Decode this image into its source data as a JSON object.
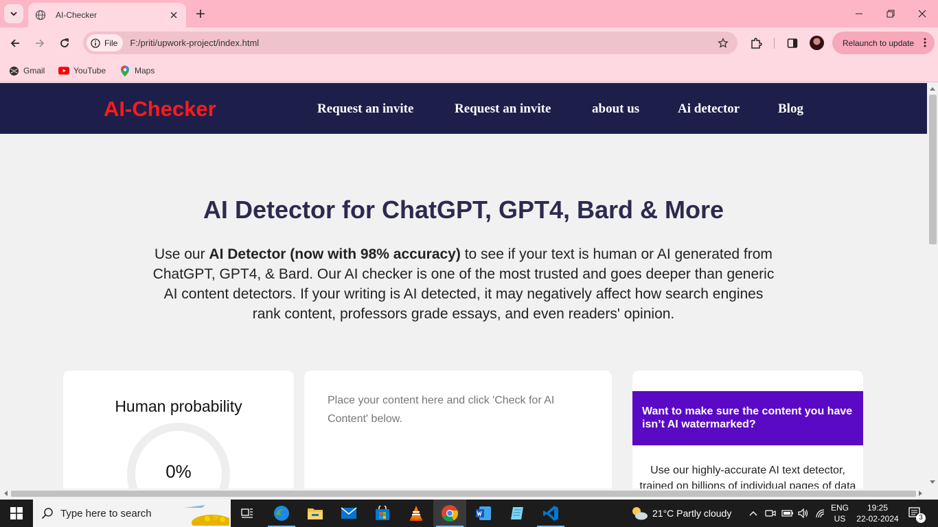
{
  "browser": {
    "tab_title": "AI-Checker",
    "chip_label": "File",
    "url": "F:/priti/upwork-project/index.html",
    "relaunch_label": "Relaunch to update",
    "bookmarks": [
      {
        "label": "Gmail",
        "icon": "gmail-icon"
      },
      {
        "label": "YouTube",
        "icon": "youtube-icon"
      },
      {
        "label": "Maps",
        "icon": "maps-icon"
      }
    ]
  },
  "site": {
    "logo": "AI-Checker",
    "nav": [
      "Request an invite",
      "Request an invite",
      "about us",
      "Ai detector",
      "Blog"
    ],
    "hero_title": "AI Detector for ChatGPT, GPT4, Bard & More",
    "hero_text": {
      "prefix": "Use our ",
      "bold": "AI Detector (now with 98% accuracy)",
      "suffix": " to see if your text is human or AI generated from ChatGPT, GPT4, & Bard. Our AI checker is one of the most trusted and goes deeper than generic AI content detectors. If your writing is AI detected, it may negatively affect how search engines rank content, professors grade essays, and even readers' opinion."
    },
    "probability_card": {
      "title": "Human probability",
      "value": "0%"
    },
    "editor": {
      "placeholder": "Place your content here and click 'Check for AI Content' below."
    },
    "promo": {
      "heading": "Want to make sure the content you have isn’t AI watermarked?",
      "body": "Use our highly-accurate AI text detector, trained on billions of individual pages of data"
    }
  },
  "taskbar": {
    "search_placeholder": "Type here to search",
    "weather": "21°C  Partly cloudy",
    "lang_top": "ENG",
    "lang_bottom": "US",
    "time": "19:25",
    "date": "22-02-2024",
    "notification_count": "3"
  },
  "colors": {
    "tab_bar": "#fdb6c5",
    "toolbar": "#ffd9e1",
    "site_nav": "#1e1e4b",
    "logo": "#ff1a1a",
    "promo": "#5a09c4"
  }
}
